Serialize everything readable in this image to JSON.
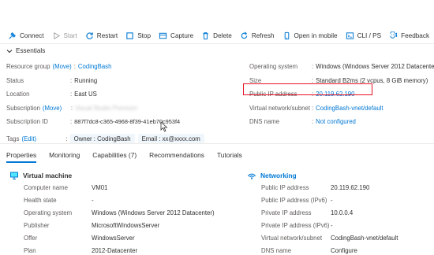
{
  "toolbar": {
    "connect": "Connect",
    "start": "Start",
    "restart": "Restart",
    "stop": "Stop",
    "capture": "Capture",
    "delete": "Delete",
    "refresh": "Refresh",
    "open_mobile": "Open in mobile",
    "cli_ps": "CLI / PS",
    "feedback": "Feedback"
  },
  "essentials": {
    "label": "Essentials",
    "left": {
      "resource_group_key": "Resource group",
      "resource_group_move": "(Move)",
      "resource_group_val": "CodingBash",
      "status_key": "Status",
      "status_val": "Running",
      "location_key": "Location",
      "location_val": "East US",
      "subscription_key": "Subscription",
      "subscription_move": "(Move)",
      "subscription_val": "Visual Studio Premium",
      "subscription_id_key": "Subscription ID",
      "subscription_id_val": "887f7dc8-c365-4968-8f39-41eb70c953f4"
    },
    "right": {
      "os_key": "Operating system",
      "os_val": "Windows (Windows Server 2012 Datacenter)",
      "size_key": "Size",
      "size_val": "Standard B2ms (2 vcpus, 8 GiB memory)",
      "public_ip_key": "Public IP address",
      "public_ip_val": "20.119.62.190",
      "vnet_key": "Virtual network/subnet",
      "vnet_val": "CodingBash-vnet/default",
      "dns_key": "DNS name",
      "dns_val": "Not configured"
    },
    "tags": {
      "key": "Tags",
      "edit": "(Edit)",
      "items": [
        "Owner : CodingBash",
        "Email : xx@xxxx.com"
      ]
    }
  },
  "tabs": [
    "Properties",
    "Monitoring",
    "Capabilities (7)",
    "Recommendations",
    "Tutorials"
  ],
  "virtual_machine": {
    "title": "Virtual machine",
    "rows": [
      {
        "key": "Computer name",
        "val": "VM01"
      },
      {
        "key": "Health state",
        "val": "-"
      },
      {
        "key": "Operating system",
        "val": "Windows (Windows Server 2012 Datacenter)"
      },
      {
        "key": "Publisher",
        "val": "MicrosoftWindowsServer"
      },
      {
        "key": "Offer",
        "val": "WindowsServer"
      },
      {
        "key": "Plan",
        "val": "2012-Datacenter"
      }
    ]
  },
  "networking": {
    "title": "Networking",
    "rows": [
      {
        "key": "Public IP address",
        "val": "20.119.62.190"
      },
      {
        "key": "Public IP address (IPv6)",
        "val": "-"
      },
      {
        "key": "Private IP address",
        "val": "10.0.0.4"
      },
      {
        "key": "Private IP address (IPv6)",
        "val": "-"
      },
      {
        "key": "Virtual network/subnet",
        "val": "CodingBash-vnet/default"
      },
      {
        "key": "DNS name",
        "val": "Configure"
      }
    ]
  },
  "colors": {
    "accent": "#0078d4",
    "highlight": "#e81123"
  }
}
